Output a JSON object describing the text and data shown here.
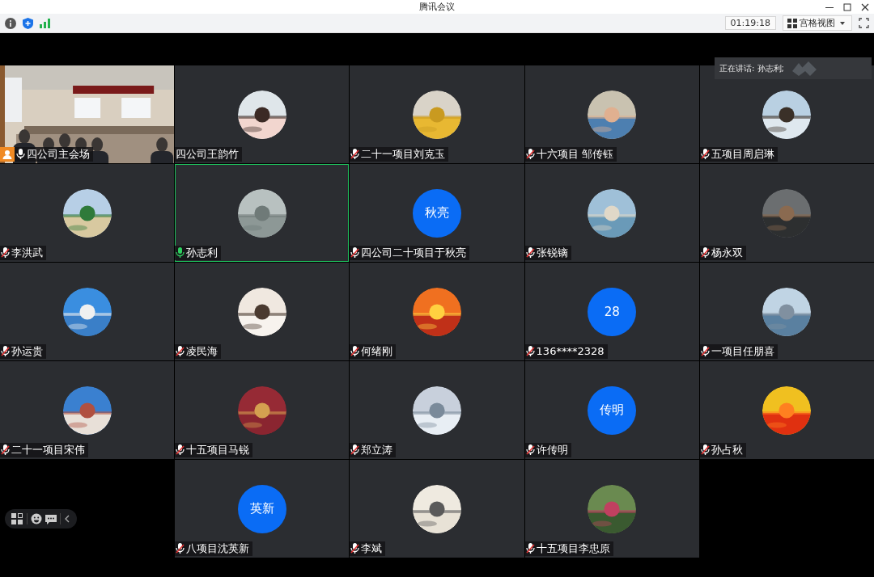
{
  "window": {
    "title": "腾讯会议"
  },
  "toolbar": {
    "timer": "01:19:18",
    "view_mode": "宫格视图"
  },
  "speaking_banner": {
    "label": "正在讲话: 孙志利;"
  },
  "tiles": [
    {
      "name": "四公司主会场",
      "mic": {
        "muted": false
      },
      "host": true,
      "speaking": false,
      "avatar": {
        "kind": "video"
      }
    },
    {
      "name": "四公司王韵竹",
      "host": false,
      "speaking": false
    },
    {
      "name": "二十一项目刘克玉",
      "mic": {
        "muted": true
      },
      "host": false,
      "speaking": false
    },
    {
      "name": "十六项目 邹传钰",
      "mic": {
        "muted": true
      },
      "host": false,
      "speaking": false
    },
    {
      "name": "五项目周启琳",
      "mic": {
        "muted": true
      },
      "host": false,
      "speaking": false
    },
    {
      "name": "李洪武",
      "mic": {
        "muted": true
      },
      "host": false,
      "speaking": false
    },
    {
      "name": "孙志利",
      "mic": {
        "muted": false
      },
      "host": false,
      "speaking": true
    },
    {
      "name": "四公司二十项目于秋亮",
      "mic": {
        "muted": true
      },
      "host": false,
      "speaking": false,
      "avatar": {
        "kind": "initials",
        "text": "秋亮"
      }
    },
    {
      "name": "张锐镝",
      "mic": {
        "muted": true
      },
      "host": false,
      "speaking": false
    },
    {
      "name": "杨永双",
      "mic": {
        "muted": true
      },
      "host": false,
      "speaking": false
    },
    {
      "name": "孙运贵",
      "mic": {
        "muted": true
      },
      "host": false,
      "speaking": false
    },
    {
      "name": "凌民海",
      "mic": {
        "muted": true
      },
      "host": false,
      "speaking": false
    },
    {
      "name": "何绪刚",
      "mic": {
        "muted": true
      },
      "host": false,
      "speaking": false
    },
    {
      "name": "136****2328",
      "mic": {
        "muted": true
      },
      "host": false,
      "speaking": false,
      "avatar": {
        "kind": "initials",
        "text": "28"
      }
    },
    {
      "name": "一项目任朋喜",
      "mic": {
        "muted": true
      },
      "host": false,
      "speaking": false
    },
    {
      "name": "二十一项目宋伟",
      "mic": {
        "muted": true
      },
      "host": false,
      "speaking": false
    },
    {
      "name": "十五项目马锐",
      "mic": {
        "muted": true
      },
      "host": false,
      "speaking": false
    },
    {
      "name": "郑立涛",
      "mic": {
        "muted": true
      },
      "host": false,
      "speaking": false
    },
    {
      "name": "许传明",
      "mic": {
        "muted": true
      },
      "host": false,
      "speaking": false,
      "avatar": {
        "kind": "initials",
        "text": "传明"
      }
    },
    {
      "name": "孙占秋",
      "mic": {
        "muted": true
      },
      "host": false,
      "speaking": false
    },
    {
      "name": "八项目沈英新",
      "mic": {
        "muted": true
      },
      "host": false,
      "speaking": false,
      "avatar": {
        "kind": "initials",
        "text": "英新"
      }
    },
    {
      "name": "李斌",
      "mic": {
        "muted": true
      },
      "host": false,
      "speaking": false
    },
    {
      "name": "十五项目李忠原",
      "mic": {
        "muted": true
      },
      "host": false,
      "speaking": false
    }
  ]
}
